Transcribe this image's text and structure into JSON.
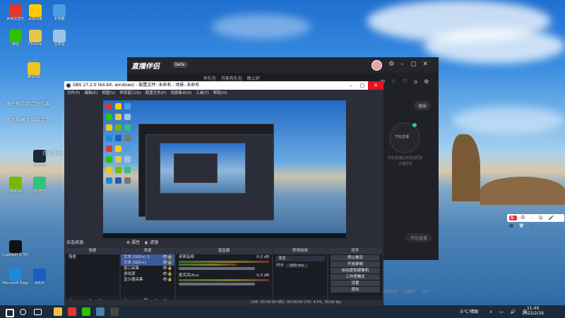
{
  "desktop": {
    "icons": [
      {
        "label": "网易云音乐",
        "color": "#e2372b"
      },
      {
        "label": "百度网盘",
        "color": "#ffcc00"
      },
      {
        "label": "此电脑",
        "color": "#4f9be0"
      },
      {
        "label": "微信",
        "color": "#2dc100"
      },
      {
        "label": "Chrome",
        "color": "#e8c64a"
      },
      {
        "label": "回收站",
        "color": "#9fc3e6"
      },
      {
        "label": "腾讯QQ",
        "color": "#f3c41f"
      },
      {
        "label": "Steam",
        "color": "#1b2838"
      },
      {
        "label": "NVIDIA",
        "color": "#76b900"
      },
      {
        "label": "QQ音乐",
        "color": "#31c27c"
      },
      {
        "label": "Logitech G HUB",
        "color": "#111111"
      },
      {
        "label": "Microsoft Edge",
        "color": "#1c8ad8"
      },
      {
        "label": "ASUS",
        "color": "#1a5bc5"
      }
    ],
    "overlay_lines": [
      "按住拖动到合适位置",
      "本应用需求屏幕共享",
      "在直播间"
    ]
  },
  "streaming_app": {
    "logo": "直播伴侣",
    "version_badge": "beta",
    "menu": [
      "有礼包",
      "万能有礼包",
      "晚上好"
    ],
    "exit_button": "退出",
    "start_circle": "开始直播",
    "hint": "开启直播后将自动同步主播信息",
    "bottom_items": [
      "直播设置",
      "直播间",
      "更多"
    ],
    "start_button": "开始直播",
    "top_icons": [
      "history-icon",
      "shirt-icon",
      "bell-icon",
      "home-icon",
      "settings-icon"
    ]
  },
  "obs": {
    "title": "OBS 27.2.0 (64-bit, windows) - 配置文件: 未命名 - 场景: 未命名",
    "menu": [
      "文件(F)",
      "编辑(E)",
      "视图(V)",
      "停靠窗口(D)",
      "配置文件(P)",
      "场景集合(S)",
      "工具(T)",
      "帮助(H)"
    ],
    "no_source": "未选择源",
    "scene_buttons": [
      "属性",
      "滤镜"
    ],
    "docks": {
      "scenes": {
        "header": "场景",
        "items": [
          "场景"
        ]
      },
      "sources": {
        "header": "来源",
        "items": [
          "文本 (GDI+) 2",
          "文本 (GDI+)",
          "窗口采集",
          "游戏源",
          "显示器采集"
        ]
      },
      "mixer": {
        "header": "混音器",
        "tracks": [
          {
            "name": "桌面音频",
            "value": "0.0 dB"
          },
          {
            "name": "麦克风/Aux",
            "value": "0.0 dB"
          }
        ]
      },
      "transitions": {
        "header": "转场特效",
        "type": "渐变",
        "duration_label": "时长",
        "duration": "300 ms"
      },
      "controls": {
        "header": "控件",
        "buttons": [
          "停止推流",
          "开始录制",
          "启动虚拟摄像机",
          "工作室模式",
          "设置",
          "退出"
        ]
      }
    },
    "status": "LIVE: 00:00:00   REC: 00:00:00   CPU: 4.0%, 30.00 fps"
  },
  "taskbar": {
    "weather": "-5°C 晴朗",
    "time": "11:40",
    "date": "2022/2/16",
    "apps": [
      {
        "name": "start-icon",
        "color": "#ffffff"
      },
      {
        "name": "search-icon",
        "color": "#ffffff"
      },
      {
        "name": "task-view-icon",
        "color": "#ffffff"
      },
      {
        "name": "explorer-icon",
        "color": "#f0c040"
      },
      {
        "name": "live-app-icon",
        "color": "#e2372b"
      },
      {
        "name": "wechat-icon",
        "color": "#2dc100"
      },
      {
        "name": "steam-icon",
        "color": "#4a7fb0"
      },
      {
        "name": "obs-icon",
        "color": "#444444"
      }
    ]
  },
  "ime": {
    "brand": "S",
    "items": "中 ◦ ☺ 🎤 ▦ 👕 ⋯"
  }
}
